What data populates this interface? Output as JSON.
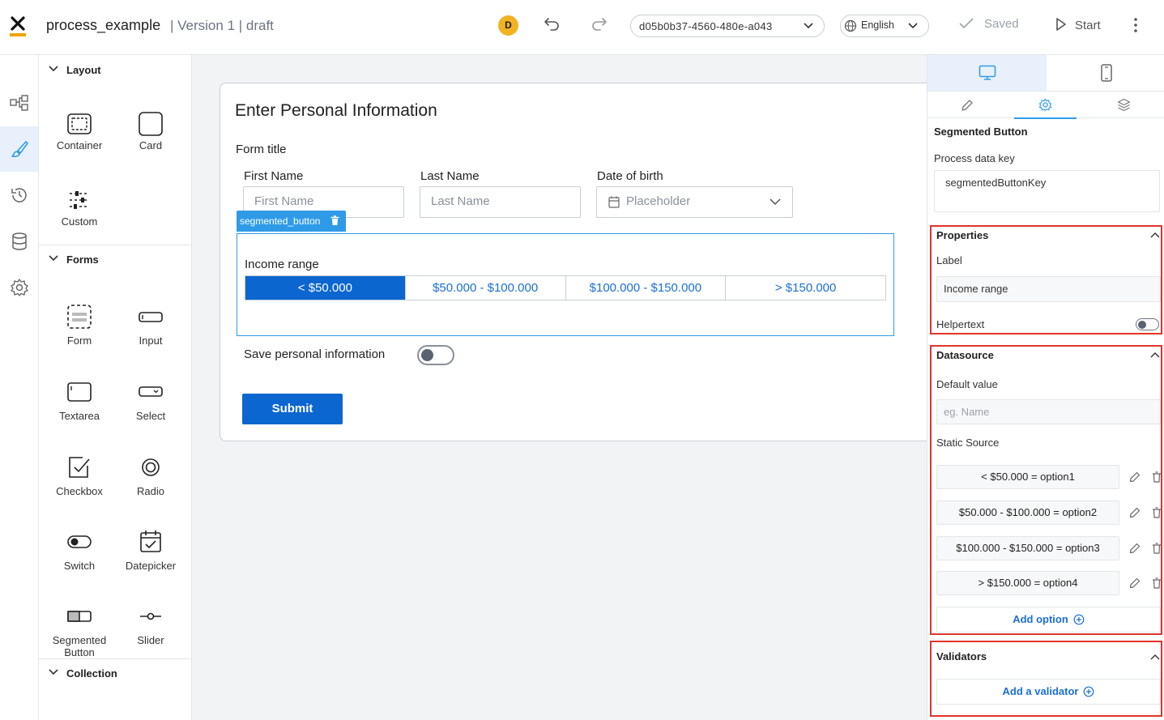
{
  "header": {
    "title": "process_example",
    "meta": "| Version 1 | draft",
    "avatar_initial": "D",
    "process_id": "d05b0b37-4560-480e-a043",
    "language": "English",
    "saved_label": "Saved",
    "start_label": "Start"
  },
  "rail": {
    "icons": [
      "process-map-icon",
      "brush-icon",
      "history-icon",
      "database-icon",
      "settings-icon"
    ],
    "active_index": 1
  },
  "palette": {
    "layout": {
      "title": "Layout",
      "items": [
        "Container",
        "Card",
        "Custom"
      ]
    },
    "forms": {
      "title": "Forms",
      "items": [
        "Form",
        "Input",
        "Textarea",
        "Select",
        "Checkbox",
        "Radio",
        "Switch",
        "Datepicker",
        "Segmented Button",
        "Slider"
      ]
    },
    "collection": {
      "title": "Collection"
    }
  },
  "canvas": {
    "heading": "Enter Personal Information",
    "form_title": "Form title",
    "fields": [
      {
        "label": "First Name",
        "placeholder": "First Name"
      },
      {
        "label": "Last Name",
        "placeholder": "Last Name"
      },
      {
        "label": "Date of birth",
        "placeholder": "Placeholder"
      }
    ],
    "selection_badge": "segmented_button",
    "segmented": {
      "label": "Income range",
      "options": [
        "< $50.000",
        "$50.000 - $100.000",
        "$100.000 - $150.000",
        "> $150.000"
      ],
      "selected_index": 0
    },
    "save_label": "Save personal information",
    "save_toggle_on": false,
    "submit_label": "Submit"
  },
  "right_panel": {
    "component_title": "Segmented Button",
    "process_key_label": "Process data key",
    "process_key_value": "segmentedButtonKey",
    "properties": {
      "title": "Properties",
      "label_label": "Label",
      "label_value": "Income range",
      "helpertext_label": "Helpertext",
      "helpertext_on": false
    },
    "datasource": {
      "title": "Datasource",
      "default_value_label": "Default value",
      "default_value_placeholder": "eg. Name",
      "static_source_label": "Static Source",
      "options": [
        "< $50.000 = option1",
        "$50.000 - $100.000 = option2",
        "$100.000 - $150.000 = option3",
        "> $150.000 = option4"
      ],
      "add_option_label": "Add option"
    },
    "validators": {
      "title": "Validators",
      "add_label": "Add a validator"
    }
  },
  "colors": {
    "accent": "#0c66d0",
    "selection": "#2f9be8",
    "highlight": "#e0352b",
    "avatar": "#f1b322"
  }
}
